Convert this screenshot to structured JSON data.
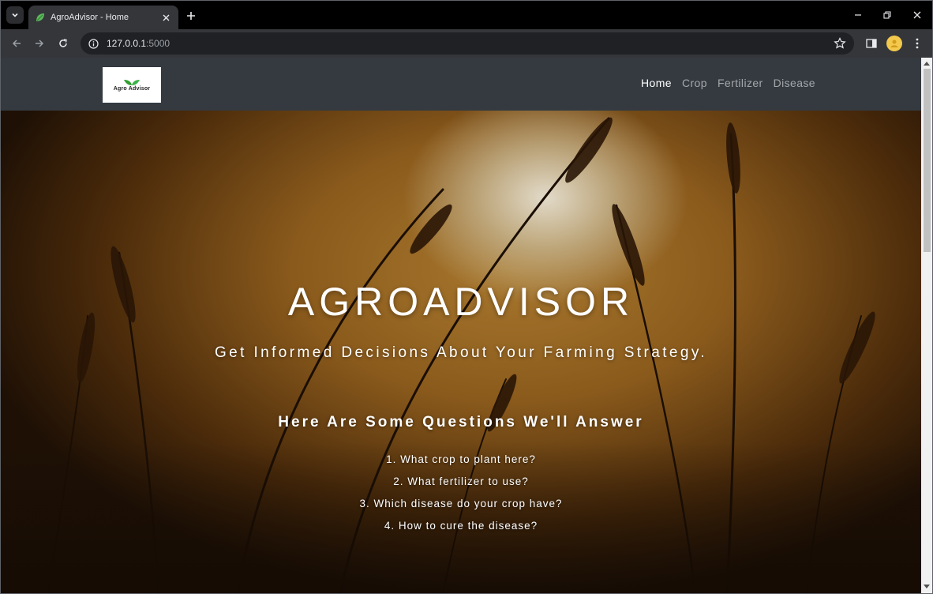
{
  "browser": {
    "tab_title": "AgroAdvisor - Home",
    "url_host": "127.0.0.1",
    "url_port": ":5000"
  },
  "site": {
    "logo_text": "Agro Advisor",
    "nav": [
      {
        "label": "Home",
        "active": true
      },
      {
        "label": "Crop",
        "active": false
      },
      {
        "label": "Fertilizer",
        "active": false
      },
      {
        "label": "Disease",
        "active": false
      }
    ]
  },
  "hero": {
    "title": "AGROADVISOR",
    "subtitle": "Get Informed Decisions About Your Farming Strategy.",
    "questions_heading": "Here Are Some Questions We'll Answer",
    "questions": [
      "1. What crop to plant here?",
      "2. What fertilizer to use?",
      "3. Which disease do your crop have?",
      "4. How to cure the disease?"
    ]
  },
  "icons": {
    "tab_search": "chevron-down-icon",
    "favicon": "leaf-icon",
    "tab_close": "close-icon",
    "new_tab": "plus-icon",
    "minimize": "minimize-icon",
    "restore": "restore-icon",
    "close_window": "close-icon",
    "back": "arrow-left-icon",
    "forward": "arrow-right-icon",
    "reload": "reload-icon",
    "site_info": "info-icon",
    "bookmark": "star-icon",
    "side_panel": "side-panel-icon",
    "profile": "avatar-icon",
    "menu": "kebab-menu-icon"
  },
  "colors": {
    "navbar_bg": "#343a40",
    "nav_active": "#ffffff",
    "nav_inactive": "rgba(255,255,255,0.55)",
    "chrome_dark": "#35363a"
  }
}
